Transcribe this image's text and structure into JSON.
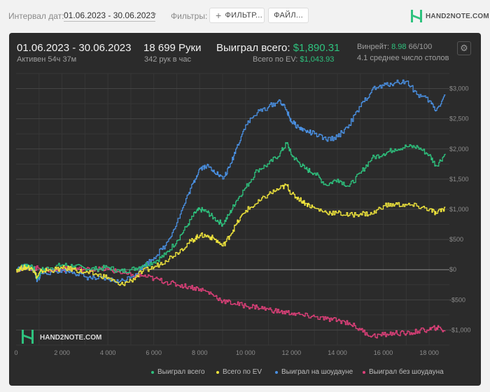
{
  "toolbar": {
    "interval_label": "Интервал дат:",
    "date_range": "01.06.2023 - 30.06.2023",
    "filters_label": "Фильтры:",
    "filter_button": "ФИЛЬТР...",
    "file_button": "ФАЙЛ...",
    "logo_text": "HAND2NOTE.COM"
  },
  "summary": {
    "period": "01.06.2023 - 30.06.2023",
    "active": "Активен 54ч 37м",
    "hands": "18 699 Руки",
    "hands_per_hour": "342 рук в час",
    "won_label": "Выиграл всего:",
    "won_value": "$1,890.31",
    "ev_label": "Всего по EV:",
    "ev_value": "$1,043.93",
    "winrate_label": "Винрейт:",
    "winrate_value": "8.98",
    "winrate_hands": "66/100",
    "tables": "4.1 среднее число столов"
  },
  "watermark": "HAND2NOTE.COM",
  "colors": {
    "total": "#2ec27e",
    "ev": "#f0e53c",
    "showdown": "#4a90e2",
    "nonshowdown": "#e0407a"
  },
  "chart_data": {
    "type": "line",
    "xlabel": "",
    "ylabel": "",
    "xlim": [
      0,
      18699
    ],
    "ylim": [
      -1250,
      3250
    ],
    "x_ticks": [
      0,
      2000,
      4000,
      6000,
      8000,
      10000,
      12000,
      14000,
      16000,
      18000
    ],
    "x_tick_labels": [
      "0",
      "2 000",
      "4 000",
      "6 000",
      "8 000",
      "10 000",
      "12 000",
      "14 000",
      "16 000",
      "18 000"
    ],
    "y_ticks": [
      3000,
      2500,
      2000,
      1500,
      1000,
      500,
      0,
      -500,
      -1000
    ],
    "y_tick_labels": [
      "$3,000",
      "$2,500",
      "$2,000",
      "$1,500",
      "$1,000",
      "$500",
      "$0",
      "-$500",
      "-$1,000"
    ],
    "legend_position": "bottom",
    "series": [
      {
        "name": "Выиграл всего",
        "color": "#2ec27e",
        "x": [
          0,
          300,
          500,
          800,
          900,
          1100,
          1500,
          2000,
          2500,
          3000,
          3500,
          4000,
          4500,
          5000,
          5500,
          6000,
          6500,
          7000,
          7500,
          7800,
          8000,
          8300,
          8600,
          9000,
          9300,
          9600,
          10000,
          10500,
          11000,
          11500,
          11800,
          12000,
          12300,
          12600,
          13000,
          13500,
          14000,
          14500,
          15000,
          15500,
          16000,
          16500,
          17000,
          17500,
          18000,
          18300,
          18699
        ],
        "y": [
          0,
          60,
          80,
          0,
          -150,
          0,
          30,
          80,
          60,
          20,
          10,
          40,
          -30,
          0,
          70,
          130,
          250,
          480,
          760,
          940,
          1000,
          960,
          860,
          750,
          930,
          1150,
          1360,
          1650,
          1750,
          1930,
          2100,
          1900,
          1780,
          1670,
          1600,
          1400,
          1500,
          1380,
          1600,
          1850,
          1920,
          2000,
          2040,
          2030,
          1900,
          1720,
          1920
        ]
      },
      {
        "name": "Всего по EV",
        "color": "#f0e53c",
        "x": [
          0,
          300,
          500,
          800,
          900,
          1100,
          1500,
          2000,
          2500,
          3000,
          3500,
          4000,
          4500,
          5000,
          5500,
          6000,
          6500,
          7000,
          7500,
          7800,
          8000,
          8300,
          8600,
          9000,
          9300,
          9600,
          10000,
          10500,
          11000,
          11500,
          11800,
          12000,
          12300,
          12600,
          13000,
          13500,
          14000,
          14500,
          15000,
          15500,
          16000,
          16500,
          17000,
          17500,
          18000,
          18300,
          18699
        ],
        "y": [
          0,
          30,
          40,
          -10,
          -130,
          -20,
          -10,
          20,
          10,
          -50,
          -80,
          -130,
          -260,
          -180,
          -30,
          40,
          150,
          280,
          440,
          520,
          570,
          560,
          520,
          390,
          560,
          760,
          980,
          1100,
          1250,
          1350,
          1400,
          1250,
          1180,
          1100,
          1020,
          950,
          940,
          900,
          930,
          920,
          1060,
          1080,
          1070,
          1050,
          1000,
          930,
          1030
        ]
      },
      {
        "name": "Выиграл на шоудауне",
        "color": "#4a90e2",
        "x": [
          0,
          300,
          500,
          800,
          900,
          1100,
          1500,
          2000,
          2500,
          3000,
          3500,
          4000,
          4500,
          5000,
          5500,
          6000,
          6500,
          7000,
          7500,
          7800,
          8000,
          8300,
          8600,
          9000,
          9300,
          9600,
          10000,
          10500,
          11000,
          11500,
          11800,
          12000,
          12300,
          12600,
          13000,
          13500,
          14000,
          14500,
          15000,
          15500,
          16000,
          16500,
          17000,
          17500,
          18000,
          18300,
          18699
        ],
        "y": [
          0,
          40,
          60,
          -20,
          -200,
          -60,
          -40,
          -10,
          -40,
          -120,
          -150,
          -160,
          -200,
          -120,
          40,
          200,
          400,
          780,
          1250,
          1500,
          1680,
          1720,
          1650,
          1500,
          1700,
          2020,
          2400,
          2600,
          2700,
          2800,
          2620,
          2450,
          2360,
          2300,
          2250,
          2150,
          2200,
          2400,
          2700,
          2980,
          3050,
          3100,
          3120,
          2900,
          2800,
          2640,
          2900
        ]
      },
      {
        "name": "Выиграл без шоудауна",
        "color": "#e0407a",
        "x": [
          0,
          500,
          1000,
          1500,
          2000,
          2500,
          3000,
          3500,
          4000,
          4500,
          5000,
          5500,
          6000,
          6500,
          7000,
          7500,
          8000,
          8500,
          9000,
          9500,
          10000,
          10500,
          11000,
          11500,
          12000,
          12500,
          13000,
          13500,
          14000,
          14500,
          15000,
          15500,
          16000,
          16500,
          17000,
          17500,
          18000,
          18300,
          18699
        ],
        "y": [
          0,
          30,
          20,
          -10,
          0,
          20,
          0,
          10,
          0,
          -40,
          -100,
          -100,
          -150,
          -200,
          -250,
          -280,
          -320,
          -400,
          -520,
          -560,
          -600,
          -620,
          -660,
          -700,
          -720,
          -760,
          -780,
          -820,
          -840,
          -880,
          -1000,
          -1100,
          -1080,
          -1050,
          -1060,
          -1020,
          -990,
          -960,
          -1010
        ]
      }
    ]
  }
}
